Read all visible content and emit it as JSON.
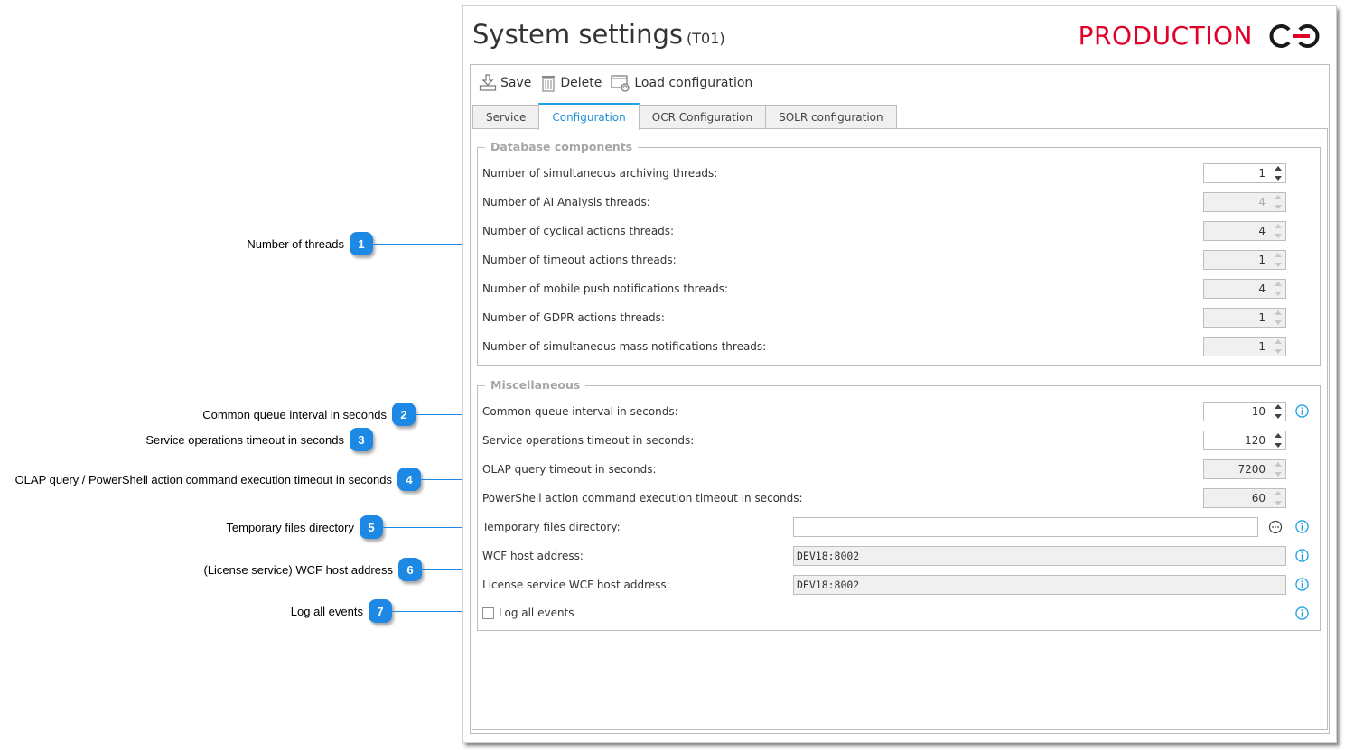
{
  "window": {
    "title": "System settings",
    "title_code": "(T01)",
    "environment_label": "PRODUCTION",
    "environment_color": "#e0002a",
    "logo_icon": "webcon-logo-icon"
  },
  "toolbar": {
    "save_label": "Save",
    "delete_label": "Delete",
    "load_label": "Load configuration"
  },
  "tabs": [
    {
      "label": "Service",
      "active": false
    },
    {
      "label": "Configuration",
      "active": true
    },
    {
      "label": "OCR Configuration",
      "active": false
    },
    {
      "label": "SOLR configuration",
      "active": false
    }
  ],
  "database_components": {
    "legend": "Database components",
    "rows": [
      {
        "label": "Number of simultaneous archiving threads:",
        "value": "1",
        "enabled": true
      },
      {
        "label": "Number of AI Analysis threads:",
        "value": "4",
        "enabled": false
      },
      {
        "label": "Number of cyclical actions threads:",
        "value": "4",
        "enabled": false
      },
      {
        "label": "Number of timeout actions threads:",
        "value": "1",
        "enabled": false
      },
      {
        "label": "Number of mobile push notifications threads:",
        "value": "4",
        "enabled": false
      },
      {
        "label": "Number of GDPR actions threads:",
        "value": "1",
        "enabled": false
      },
      {
        "label": "Number of simultaneous mass notifications threads:",
        "value": "1",
        "enabled": false
      }
    ]
  },
  "miscellaneous": {
    "legend": "Miscellaneous",
    "common_queue": {
      "label": "Common queue interval in seconds:",
      "value": "10"
    },
    "service_timeout": {
      "label": "Service operations timeout in seconds:",
      "value": "120"
    },
    "olap_timeout": {
      "label": "OLAP query timeout in seconds:",
      "value": "7200"
    },
    "powershell_timeout": {
      "label": "PowerShell action command execution timeout in seconds:",
      "value": "60"
    },
    "temp_dir": {
      "label": "Temporary files directory:",
      "value": ""
    },
    "wcf_host": {
      "label": "WCF host address:",
      "value": "DEV18:8002"
    },
    "license_wcf_host": {
      "label": "License service WCF host address:",
      "value": "DEV18:8002"
    },
    "log_all_events": {
      "label": "Log all events",
      "checked": false
    }
  },
  "callouts": [
    {
      "number": "1",
      "text": "Number of threads"
    },
    {
      "number": "2",
      "text": "Common queue interval in seconds"
    },
    {
      "number": "3",
      "text": "Service operations timeout in seconds"
    },
    {
      "number": "4",
      "text": "OLAP query / PowerShell action command execution timeout in seconds"
    },
    {
      "number": "5",
      "text": "Temporary files directory"
    },
    {
      "number": "6",
      "text": "(License service) WCF host address"
    },
    {
      "number": "7",
      "text": "Log all events"
    }
  ],
  "colors": {
    "accent": "#1ea0e6",
    "callout": "#1e88e5"
  }
}
